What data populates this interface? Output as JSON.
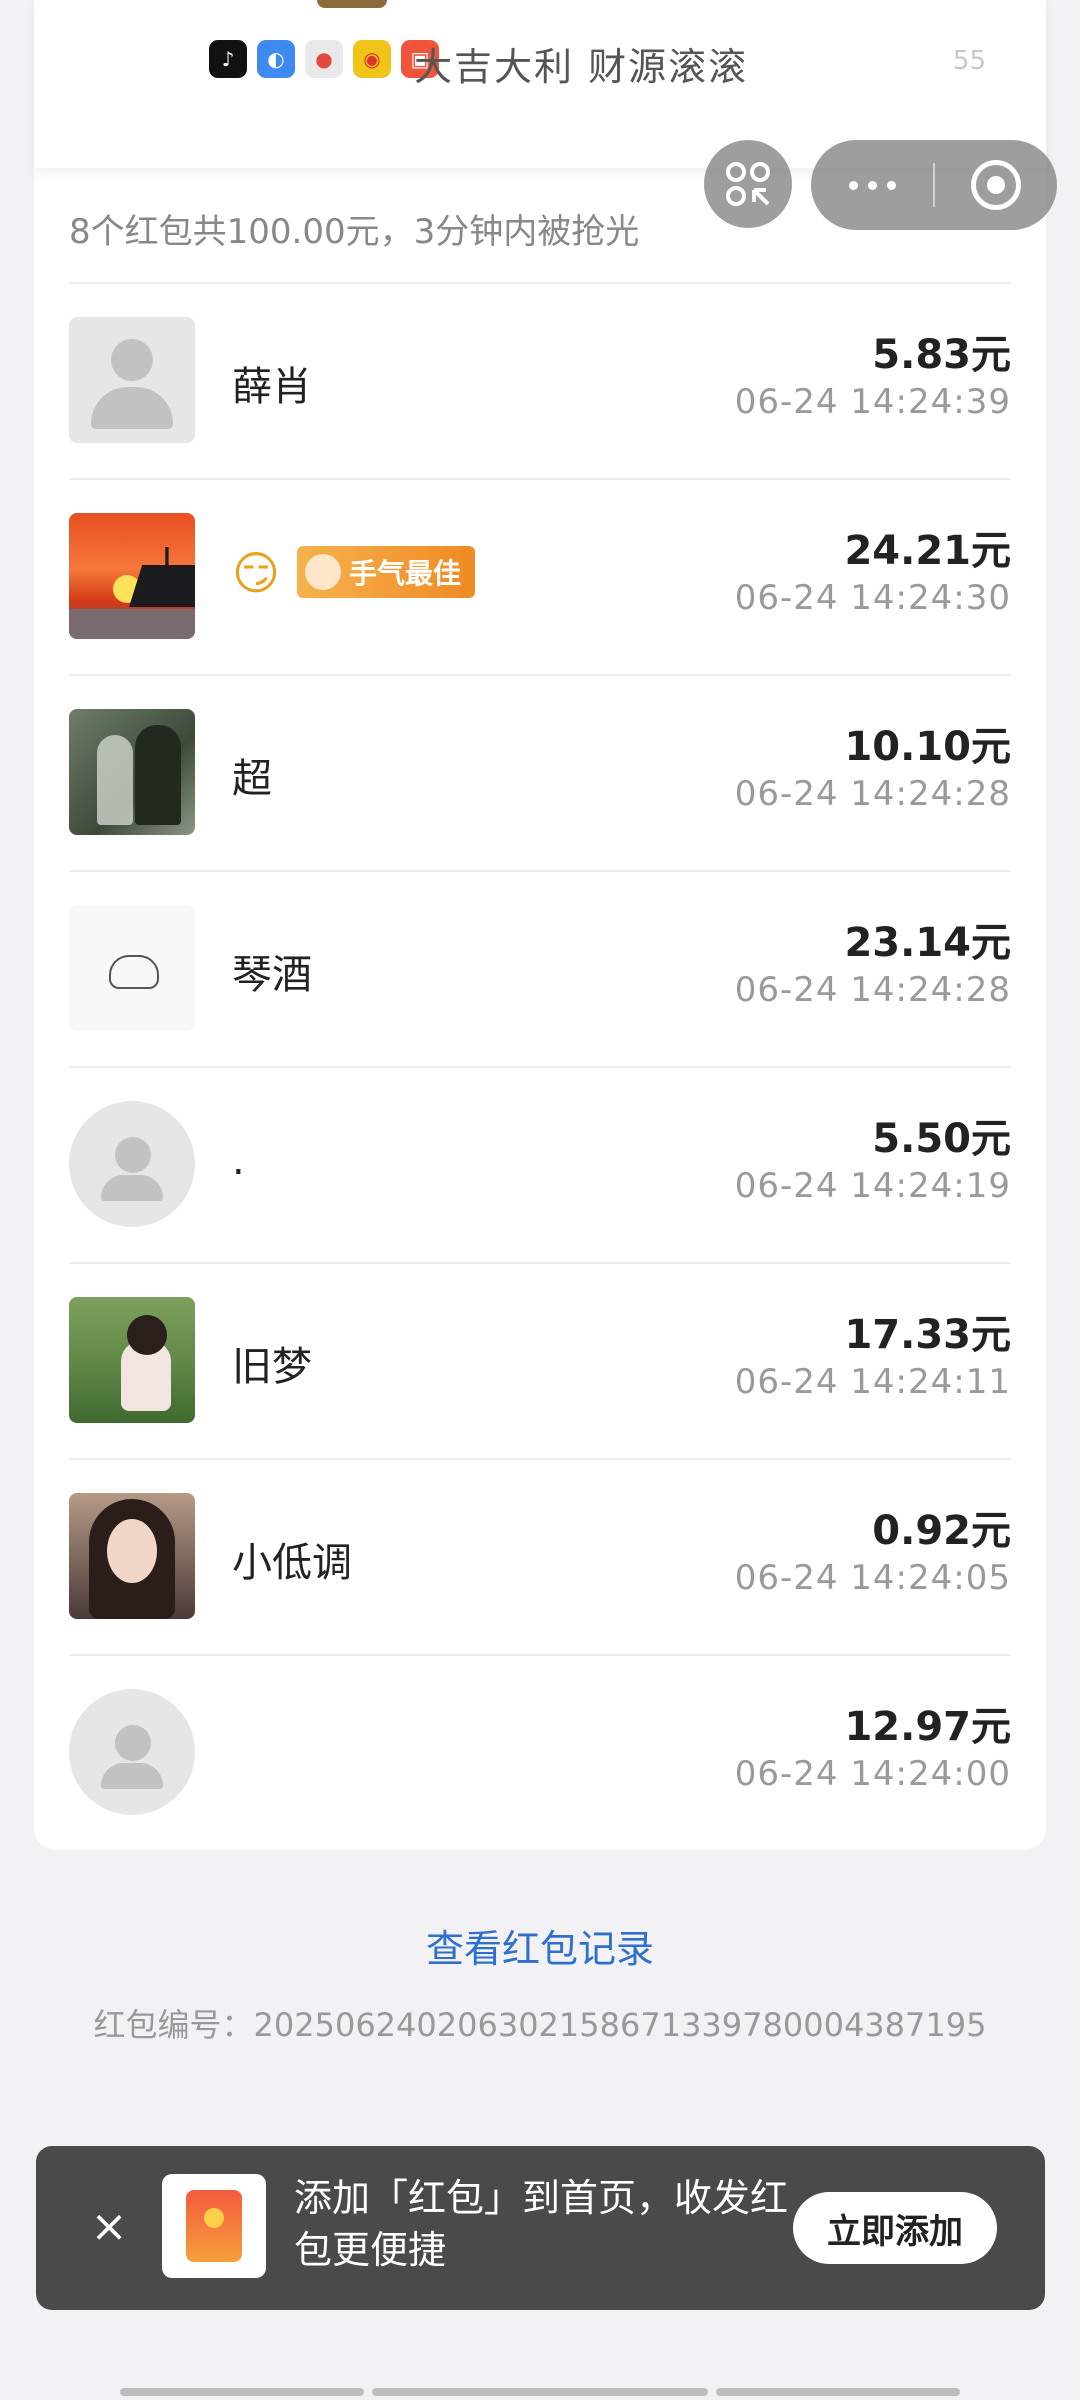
{
  "blessing": {
    "apps": [
      {
        "icon": "tiktok-icon",
        "color": "#111111",
        "glyph": "♪"
      },
      {
        "icon": "app-blue-icon",
        "color": "#3d8bf0",
        "glyph": "◐"
      },
      {
        "icon": "map-pin-icon",
        "color": "#e2e2e2",
        "glyph": "📍"
      },
      {
        "icon": "weibo-icon",
        "color": "#f0c419",
        "glyph": "◉"
      },
      {
        "icon": "red-app-icon",
        "color": "#f0553c",
        "glyph": "▣"
      }
    ],
    "text": "大吉大利 财源滚滚",
    "count": "55"
  },
  "summary": "8个红包共100.00元，3分钟内被抢光",
  "best_badge": "手气最佳",
  "recipients": [
    {
      "name": "薛肖",
      "amount": "5.83元",
      "time": "06-24 14:24:39",
      "avatar": "default-square"
    },
    {
      "name": "😏",
      "amount": "24.21元",
      "time": "06-24 14:24:30",
      "avatar": "sunset",
      "best": true
    },
    {
      "name": "超",
      "amount": "10.10元",
      "time": "06-24 14:24:28",
      "avatar": "statue"
    },
    {
      "name": "琴酒",
      "amount": "23.14元",
      "time": "06-24 14:24:28",
      "avatar": "cat-sketch"
    },
    {
      "name": ".",
      "amount": "5.50元",
      "time": "06-24 14:24:19",
      "avatar": "default-round"
    },
    {
      "name": "旧梦",
      "amount": "17.33元",
      "time": "06-24 14:24:11",
      "avatar": "child"
    },
    {
      "name": "小低调",
      "amount": "0.92元",
      "time": "06-24 14:24:05",
      "avatar": "woman"
    },
    {
      "name": "",
      "amount": "12.97元",
      "time": "06-24 14:24:00",
      "avatar": "default-round"
    }
  ],
  "records_link": "查看红包记录",
  "serial": "红包编号：2025062402063021586713397800043871​95",
  "toast": {
    "text": "添加「红包」到首页，收发红包更便捷",
    "button": "立即添加",
    "close": "×"
  },
  "colors": {
    "link": "#2f6fcd",
    "badge": "#f08a24",
    "toast_bg": "#4a4a4a"
  }
}
